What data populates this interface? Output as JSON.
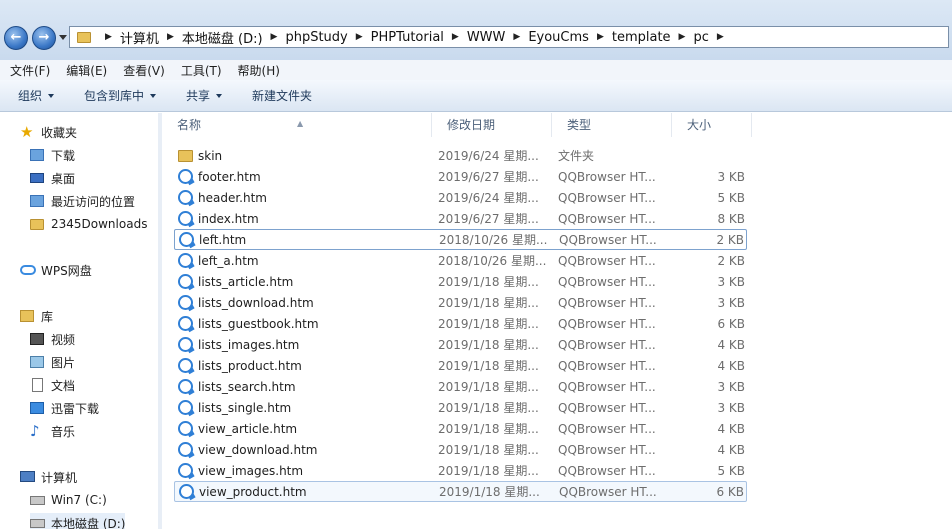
{
  "address": {
    "crumbs": [
      "计算机",
      "本地磁盘 (D:)",
      "phpStudy",
      "PHPTutorial",
      "WWW",
      "EyouCms",
      "template",
      "pc"
    ]
  },
  "menu": [
    "文件(F)",
    "编辑(E)",
    "查看(V)",
    "工具(T)",
    "帮助(H)"
  ],
  "toolbar": {
    "organize": "组织",
    "include_library": "包含到库中",
    "share": "共享",
    "new_folder": "新建文件夹"
  },
  "nav": {
    "favorites": "收藏夹",
    "downloads": "下载",
    "desktop": "桌面",
    "recent": "最近访问的位置",
    "downloads2345": "2345Downloads",
    "wps": "WPS网盘",
    "library": "库",
    "video": "视频",
    "pictures": "图片",
    "documents": "文档",
    "thunder": "迅雷下载",
    "music": "音乐",
    "computer": "计算机",
    "drive_c": "Win7 (C:)",
    "drive_d": "本地磁盘 (D:)"
  },
  "columns": {
    "name": "名称",
    "date": "修改日期",
    "type": "类型",
    "size": "大小"
  },
  "files": [
    {
      "name": "skin",
      "date": "2019/6/24 星期...",
      "type": "文件夹",
      "size": "",
      "kind": "folder"
    },
    {
      "name": "footer.htm",
      "date": "2019/6/27 星期...",
      "type": "QQBrowser HT...",
      "size": "3 KB",
      "kind": "htm"
    },
    {
      "name": "header.htm",
      "date": "2019/6/24 星期...",
      "type": "QQBrowser HT...",
      "size": "5 KB",
      "kind": "htm"
    },
    {
      "name": "index.htm",
      "date": "2019/6/27 星期...",
      "type": "QQBrowser HT...",
      "size": "8 KB",
      "kind": "htm"
    },
    {
      "name": "left.htm",
      "date": "2018/10/26 星期...",
      "type": "QQBrowser HT...",
      "size": "2 KB",
      "kind": "htm"
    },
    {
      "name": "left_a.htm",
      "date": "2018/10/26 星期...",
      "type": "QQBrowser HT...",
      "size": "2 KB",
      "kind": "htm"
    },
    {
      "name": "lists_article.htm",
      "date": "2019/1/18 星期...",
      "type": "QQBrowser HT...",
      "size": "3 KB",
      "kind": "htm"
    },
    {
      "name": "lists_download.htm",
      "date": "2019/1/18 星期...",
      "type": "QQBrowser HT...",
      "size": "3 KB",
      "kind": "htm"
    },
    {
      "name": "lists_guestbook.htm",
      "date": "2019/1/18 星期...",
      "type": "QQBrowser HT...",
      "size": "6 KB",
      "kind": "htm"
    },
    {
      "name": "lists_images.htm",
      "date": "2019/1/18 星期...",
      "type": "QQBrowser HT...",
      "size": "4 KB",
      "kind": "htm"
    },
    {
      "name": "lists_product.htm",
      "date": "2019/1/18 星期...",
      "type": "QQBrowser HT...",
      "size": "4 KB",
      "kind": "htm"
    },
    {
      "name": "lists_search.htm",
      "date": "2019/1/18 星期...",
      "type": "QQBrowser HT...",
      "size": "3 KB",
      "kind": "htm"
    },
    {
      "name": "lists_single.htm",
      "date": "2019/1/18 星期...",
      "type": "QQBrowser HT...",
      "size": "3 KB",
      "kind": "htm"
    },
    {
      "name": "view_article.htm",
      "date": "2019/1/18 星期...",
      "type": "QQBrowser HT...",
      "size": "4 KB",
      "kind": "htm"
    },
    {
      "name": "view_download.htm",
      "date": "2019/1/18 星期...",
      "type": "QQBrowser HT...",
      "size": "4 KB",
      "kind": "htm"
    },
    {
      "name": "view_images.htm",
      "date": "2019/1/18 星期...",
      "type": "QQBrowser HT...",
      "size": "5 KB",
      "kind": "htm"
    },
    {
      "name": "view_product.htm",
      "date": "2019/1/18 星期...",
      "type": "QQBrowser HT...",
      "size": "6 KB",
      "kind": "htm"
    }
  ]
}
